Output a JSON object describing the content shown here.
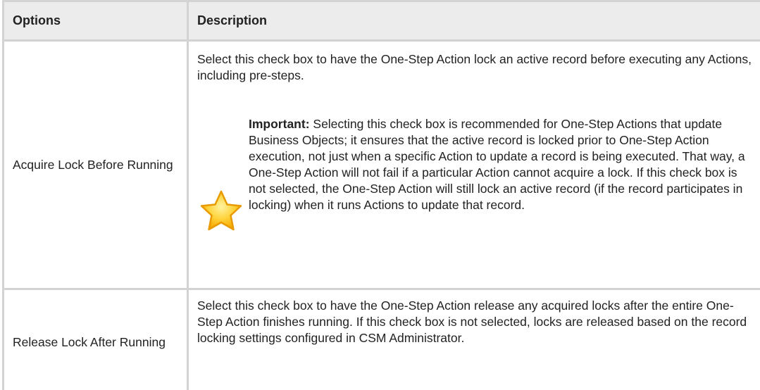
{
  "table": {
    "headers": {
      "options": "Options",
      "description": "Description"
    },
    "rows": [
      {
        "option": "Acquire Lock Before Running",
        "description": "Select this check box to have the One-Step Action lock an active record before executing any Actions, including pre-steps.",
        "note_label": "Important:",
        "note_text": " Selecting this check box is recommended for One-Step Actions that update Business Objects; it ensures that the active record is locked prior to One-Step Action execution, not just when a specific Action to update a record is being executed. That way, a One-Step Action will not fail if a particular Action cannot acquire a lock. If this check box is not selected, the One-Step Action will still lock an active record (if the record participates in locking) when it runs Actions to update that record.",
        "note_icon": "star-icon"
      },
      {
        "option": "Release Lock After Running",
        "description": "Select this check box to have the One-Step Action release any acquired locks after the entire One-Step Action finishes running. If this check box is not selected, locks are released based on the record locking settings configured in CSM Administrator."
      }
    ]
  },
  "colors": {
    "header_bg": "#ececec",
    "border": "#d3d3d3",
    "star_fill": "#ffc21a",
    "star_stroke": "#f0a000"
  }
}
